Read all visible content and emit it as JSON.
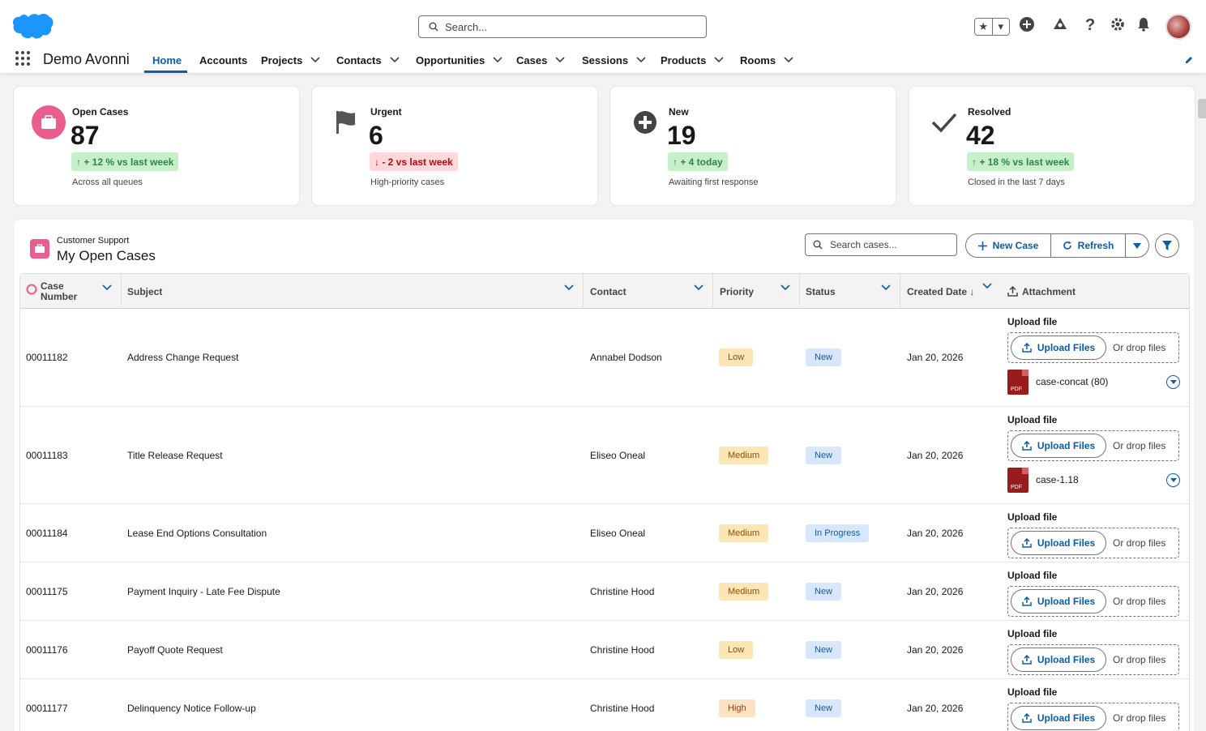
{
  "header": {
    "search_placeholder": "Search...",
    "app_name": "Demo Avonni"
  },
  "nav": {
    "items": [
      {
        "label": "Home",
        "selected": true
      },
      {
        "label": "Accounts"
      },
      {
        "label": "Projects"
      },
      {
        "label": "Contacts"
      },
      {
        "label": "Opportunities"
      },
      {
        "label": "Cases"
      },
      {
        "label": "Sessions"
      },
      {
        "label": "Products"
      },
      {
        "label": "Rooms"
      }
    ]
  },
  "kpis": [
    {
      "label": "Open Cases",
      "value": "87",
      "trend": "↑  + 12 % vs last week",
      "trend_dir": "up",
      "sub": "Across all queues",
      "icon": "briefcase-icon"
    },
    {
      "label": "Urgent",
      "value": "6",
      "trend": "↓  - 2  vs last week",
      "trend_dir": "down",
      "sub": "High-priority cases",
      "icon": "flag-icon"
    },
    {
      "label": "New",
      "value": "19",
      "trend": "↑  + 4  today",
      "trend_dir": "up",
      "sub": "Awaiting first response",
      "icon": "add-icon"
    },
    {
      "label": "Resolved",
      "value": "42",
      "trend": "↑  + 18 % vs last week",
      "trend_dir": "up",
      "sub": "Closed in the last 7 days",
      "icon": "check-icon"
    }
  ],
  "card": {
    "kicker": "Customer Support",
    "title": "My Open Cases",
    "search_placeholder": "Search cases...",
    "new_case": "New Case",
    "refresh": "Refresh"
  },
  "table": {
    "columns": {
      "case_number_1": "Case",
      "case_number_2": "Number",
      "subject": "Subject",
      "contact": "Contact",
      "priority": "Priority",
      "status": "Status",
      "created": "Created Date ↓",
      "attachment": "Attachment"
    },
    "upload_label": "Upload file",
    "upload_btn": "Upload Files",
    "drop_text": "Or drop files",
    "rows": [
      {
        "number": "00011182",
        "subject": "Address Change Request",
        "contact": "Annabel Dodson",
        "priority": "Low",
        "status": "New",
        "created": "Jan 20, 2026",
        "file": "case-concat (80)"
      },
      {
        "number": "00011183",
        "subject": "Title Release Request",
        "contact": "Eliseo Oneal",
        "priority": "Medium",
        "status": "New",
        "created": "Jan 20, 2026",
        "file": "case-1.18"
      },
      {
        "number": "00011184",
        "subject": "Lease End Options Consultation",
        "contact": "Eliseo Oneal",
        "priority": "Medium",
        "status": "In Progress",
        "created": "Jan 20, 2026",
        "file": ""
      },
      {
        "number": "00011175",
        "subject": "Payment Inquiry - Late Fee Dispute",
        "contact": "Christine Hood",
        "priority": "Medium",
        "status": "New",
        "created": "Jan 20, 2026",
        "file": ""
      },
      {
        "number": "00011176",
        "subject": "Payoff Quote Request",
        "contact": "Christine Hood",
        "priority": "Low",
        "status": "New",
        "created": "Jan 20, 2026",
        "file": ""
      },
      {
        "number": "00011177",
        "subject": "Delinquency Notice Follow-up",
        "contact": "Christine Hood",
        "priority": "High",
        "status": "New",
        "created": "Jan 20, 2026",
        "file": ""
      }
    ]
  },
  "pdf_label": "PDF",
  "colors": {
    "brand": "#0b5cab",
    "cloud": "#1b96ff",
    "case_pink": "#e95e8e"
  }
}
